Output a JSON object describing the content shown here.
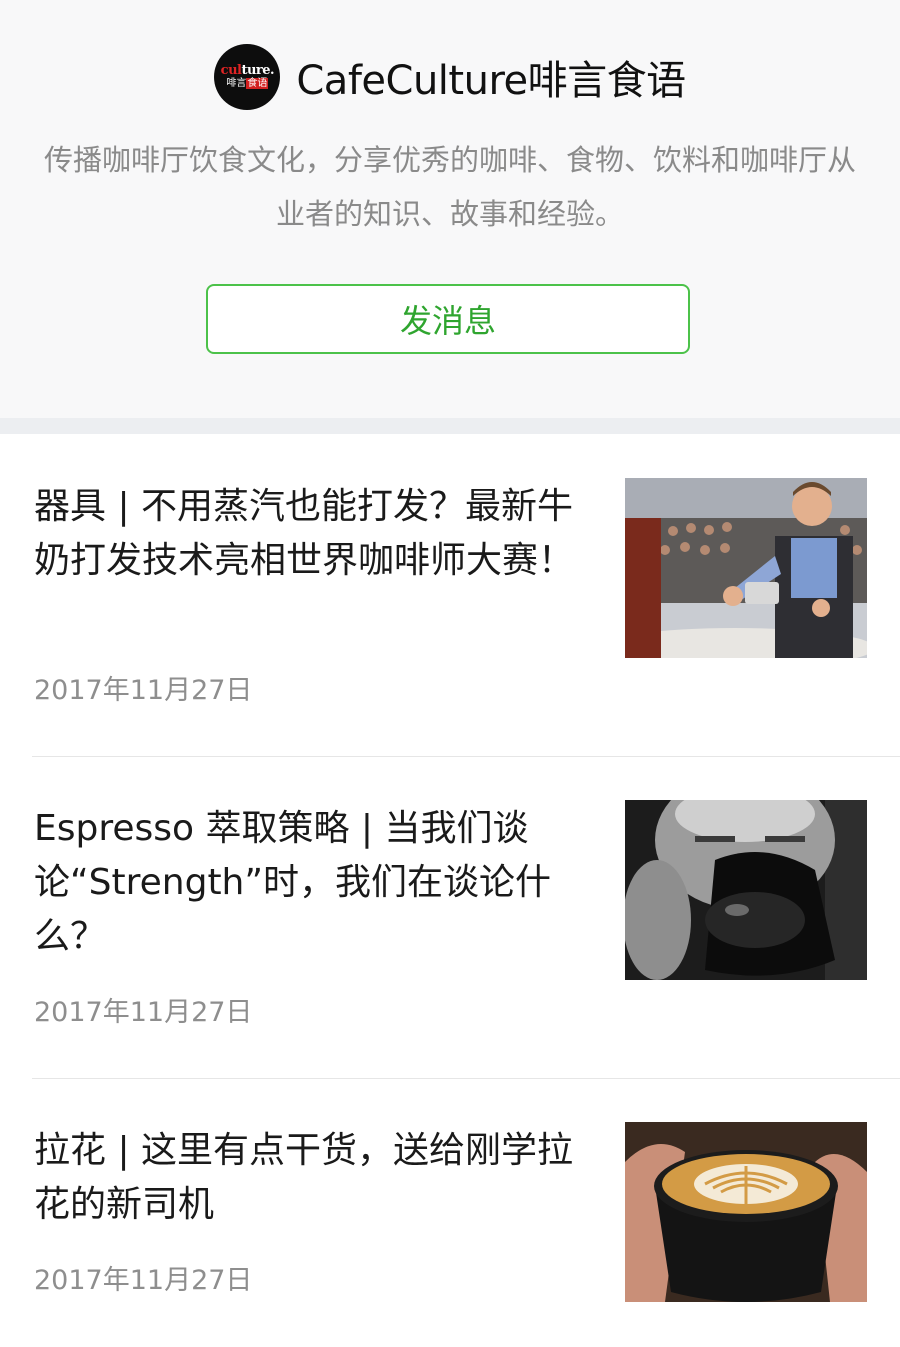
{
  "account": {
    "name": "CafeCulture啡言食语",
    "avatar_text_top": "culture.",
    "avatar_text_bottom": "啡言食语",
    "description": "传播咖啡厅饮食文化，分享优秀的咖啡、食物、饮料和咖啡厅从业者的知识、故事和经验。",
    "message_button": "发消息"
  },
  "articles": [
    {
      "title": "器具 | 不用蒸汽也能打发？最新牛奶打发技术亮相世界咖啡师大赛！",
      "date": "2017年11月27日",
      "image": "barista-competition-photo"
    },
    {
      "title": "Espresso 萃取策略 | 当我们谈论“Strength”时，我们在谈论什么？",
      "date": "2017年11月27日",
      "image": "man-drinking-coffee-photo"
    },
    {
      "title": "拉花 | 这里有点干货，送给刚学拉花的新司机",
      "date": "2017年11月27日",
      "image": "latte-art-cup-photo"
    }
  ],
  "colors": {
    "accent_green": "#4cc24a",
    "text_gray": "#8a8a8a",
    "background": "#f8f8f9"
  }
}
